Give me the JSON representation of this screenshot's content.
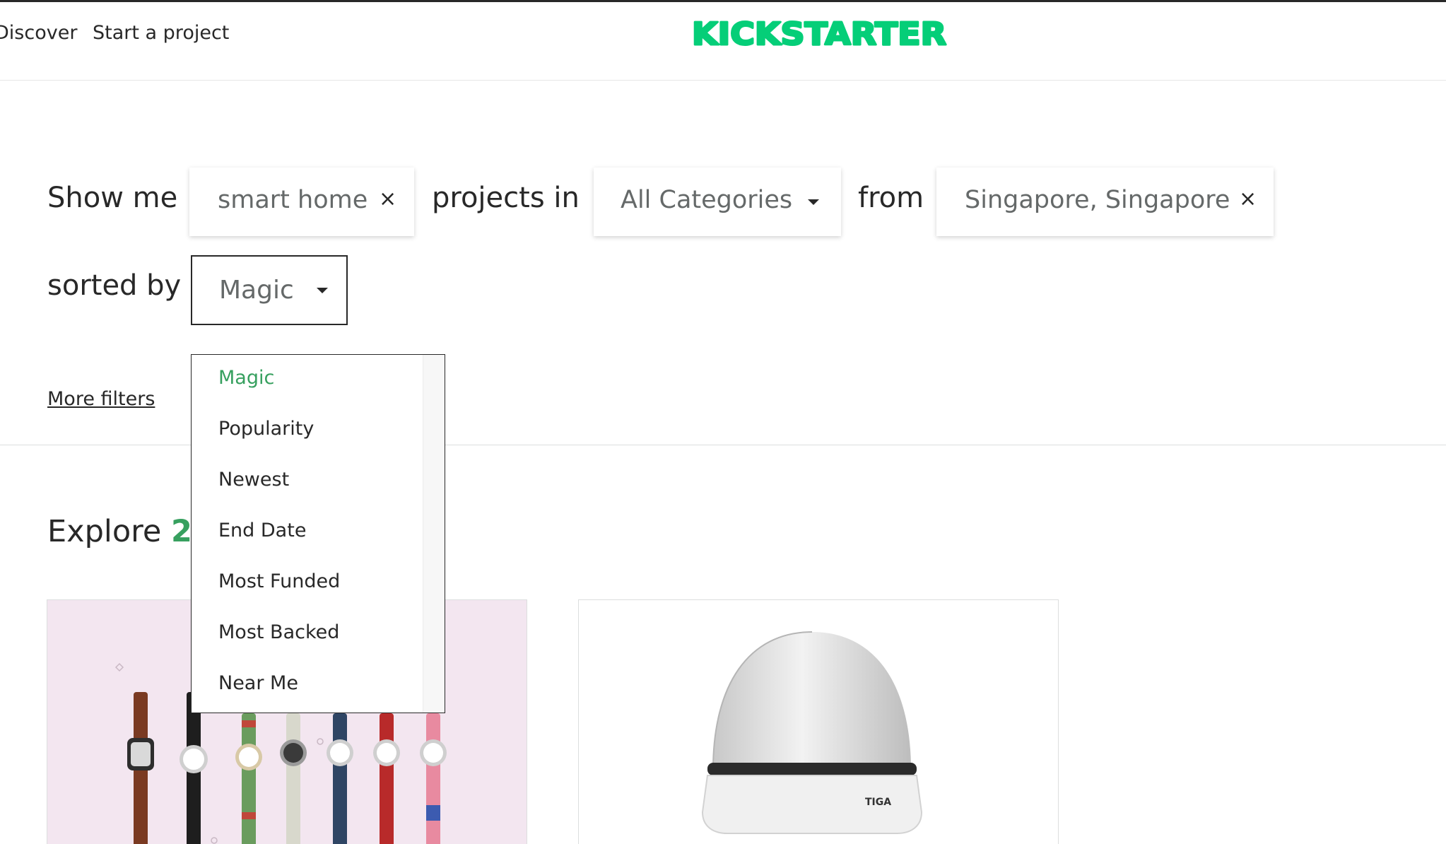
{
  "header": {
    "nav": [
      {
        "label": "Discover"
      },
      {
        "label": "Start a project"
      }
    ],
    "logo_text": "KICKSTARTER",
    "logo_color": "#05ce78",
    "border_color": "#282828"
  },
  "filters": {
    "show_me_label": "Show me",
    "search_value": "smart home",
    "projects_in_label": "projects in",
    "category_value": "All Categories",
    "from_label": "from",
    "location_value": "Singapore, Singapore",
    "sorted_by_label": "sorted by",
    "sort_value": "Magic",
    "clear_glyph": "×",
    "more_filters_label": "More filters"
  },
  "sort_dropdown": {
    "options": [
      "Magic",
      "Popularity",
      "Newest",
      "End Date",
      "Most Funded",
      "Most Backed",
      "Near Me"
    ],
    "selected": "Magic",
    "selected_color": "#37a05f"
  },
  "explore": {
    "prefix": "Explore",
    "count": "2"
  },
  "cards": [
    {
      "image": "watches-product-photo"
    },
    {
      "image": "tiga-dome-device-photo",
      "brand_text": "TIGA"
    }
  ],
  "colors": {
    "accent_green": "#37a05f",
    "text": "#282828",
    "muted_text": "#656969"
  }
}
